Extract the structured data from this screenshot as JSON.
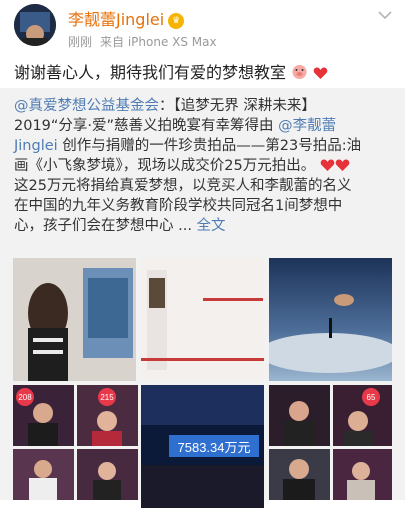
{
  "header": {
    "username": "李靓蕾Jinglei",
    "time": "刚刚",
    "source": "来自 iPhone XS Max"
  },
  "post": {
    "text": "谢谢善心人，期待我们有爱的梦想教室"
  },
  "repost": {
    "author": "@真爱梦想公益基金会",
    "l1_tail": "：【追梦无界 深耕未来】",
    "l2_text": "2019“分享·爱”慈善义拍晚宴有幸筹得由 ",
    "l2_link": "@李靓蕾",
    "l3_link": "Jinglei",
    "l3_text": " 创作与捐赠的一件珍贵拍品——第23号拍品:油",
    "l4_text": "画《小飞象梦境》，现场以成交价25万元拍出。",
    "l5_text": "这25万元将捐给真爱梦想，以竞买人和李靓蕾的名义",
    "l6_text": "在中国的九年义务教育阶段学校共同冠名1间梦想中",
    "l7_text": "心，孩子们会在梦想中心 ...",
    "more": "全文"
  },
  "images": {
    "banner_amount": "7583.34万元",
    "paddle_labels": [
      "208",
      "215",
      "65"
    ]
  },
  "colors": {
    "username": "#e8710a",
    "link": "#4f7cb3",
    "repost_bg": "#f2f2f2"
  }
}
